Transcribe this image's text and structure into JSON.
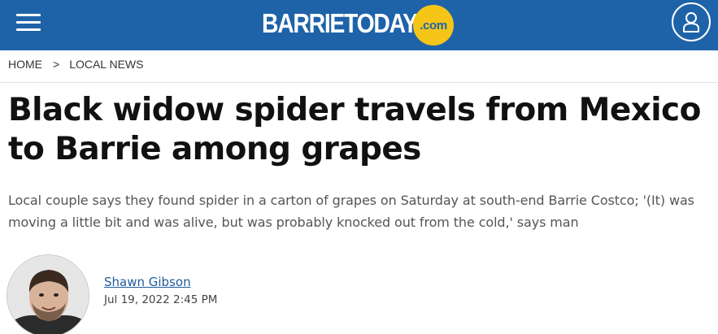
{
  "header": {
    "menu_icon": "hamburger-menu-icon",
    "logo": {
      "word": "BARRIETODAY",
      "suffix": ".com"
    },
    "account_icon": "user-account-icon",
    "bar_color": "#1e63a8",
    "logo_badge_color": "#f5c518"
  },
  "breadcrumb": {
    "home": "HOME",
    "separator": ">",
    "section": "LOCAL NEWS"
  },
  "article": {
    "headline": "Black widow spider travels from Mexico to Barrie among grapes",
    "dek": "Local couple says they found spider in a carton of grapes on Saturday at south-end Barrie Costco; '(It) was moving a little bit and was alive, but was probably knocked out from the cold,' says man",
    "author": {
      "name": "Shawn Gibson",
      "date": "Jul 19, 2022 2:45 PM",
      "link_color": "#1e5a99"
    }
  }
}
